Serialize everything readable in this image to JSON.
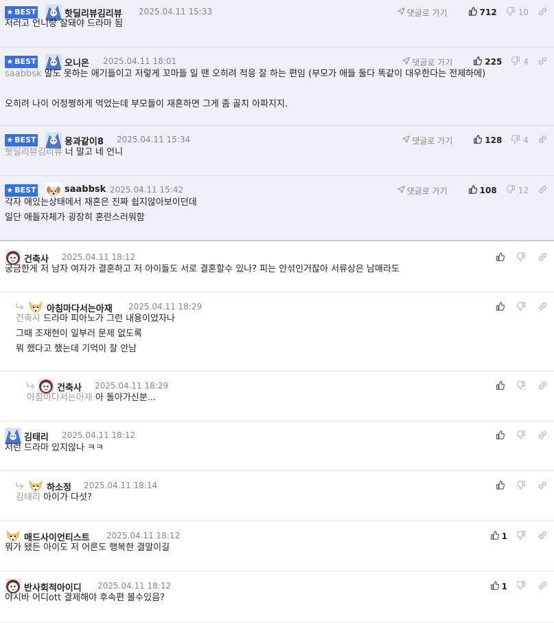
{
  "labels": {
    "best": "BEST",
    "reply": "댓글로 가기"
  },
  "colors": {
    "badge": "#3a6fd8",
    "best_bg": "#eef1f9"
  },
  "comments": [
    {
      "best": true,
      "nick": "핫딜리뷰김리뷰",
      "date": "2025.04.11 15:33",
      "likes": "712",
      "dislikes": "10",
      "mention": "",
      "lines": [
        "저러고 언니랑 잘돼야 드라마 됨"
      ],
      "avatar": "blue-avatar"
    },
    {
      "best": true,
      "nick": "오니온",
      "date": "2025.04.11 18:01",
      "likes": "225",
      "dislikes": "4",
      "mention": "saabbsk",
      "lines": [
        "말도 못하는 애기들이고 저렇게 꼬마들 일 땐 오히려 적응 잘 하는 편임 (부모가 애들 둘다 똑같이 대우한다는 전제하에)",
        "",
        "오히려 나이 어정쩡하게 먹었는데 부모들이 재혼하면 그게 좀 골치 아파지지."
      ],
      "avatar": "blue-avatar"
    },
    {
      "best": true,
      "nick": "용과같이8",
      "date": "2025.04.11 15:34",
      "likes": "128",
      "dislikes": "4",
      "mention": "핫딜리뷰김리뷰",
      "lines": [
        "너 말고 네 언니"
      ],
      "avatar": "blue-avatar"
    },
    {
      "best": true,
      "nick": "saabbsk",
      "date": "2025.04.11 15:42",
      "likes": "108",
      "dislikes": "12",
      "mention": "",
      "lines": [
        "각자 애있는상태에서 재혼은 진짜 쉽지않아보이던데",
        "일단 애들자체가 굉장히 혼란스러워함"
      ],
      "avatar": "dog-avatar"
    },
    {
      "best": false,
      "nick": "건축사",
      "date": "2025.04.11 18:12",
      "likes": "",
      "dislikes": "",
      "mention": "",
      "lines": [
        "궁금한게 저 남자 여자가 결혼하고 저 아이들도 서로 결혼할수 있나? 피는 안섞인거잖아 서류상은 남매라도"
      ],
      "avatar": "face-avatar"
    },
    {
      "best": false,
      "nick": "아침마다서는아재",
      "date": "2025.04.11 18:29",
      "likes": "",
      "dislikes": "",
      "mention": "건축사",
      "lines": [
        "드라마 피아노가 그런 내용이었자나",
        "그때 조재현이 일부러 문제 없도록",
        "뭐 했다고 했는데 기억이 잘 안남"
      ],
      "avatar": "fox-avatar"
    },
    {
      "best": false,
      "nick": "건축사",
      "date": "2025.04.11 18:29",
      "likes": "",
      "dislikes": "",
      "mention": "아침마다서는아재",
      "lines": [
        "아 돌아가신분..."
      ],
      "avatar": "face-avatar"
    },
    {
      "best": false,
      "nick": "김태리",
      "date": "2025.04.11 18:12",
      "likes": "",
      "dislikes": "",
      "mention": "",
      "lines": [
        "저런 드라마 있지않나 ㅋㅋ"
      ],
      "avatar": "blue-avatar"
    },
    {
      "best": false,
      "nick": "하소정",
      "date": "2025.04.11 18:14",
      "likes": "",
      "dislikes": "",
      "mention": "김태리",
      "lines": [
        "아이가 다섯?"
      ],
      "avatar": "fox-avatar"
    },
    {
      "best": false,
      "nick": "매드사이언티스트",
      "date": "2025.04.11 18:12",
      "likes": "1",
      "dislikes": "",
      "mention": "",
      "lines": [
        "뭐가 됐든 아이도 저 어른도 행복한 결말이길"
      ],
      "avatar": "fox-avatar"
    },
    {
      "best": false,
      "nick": "반사회적아이디",
      "date": "2025.04.11 18:12",
      "likes": "1",
      "dislikes": "",
      "mention": "",
      "lines": [
        "야시바 어디ott 결제해야 후속편 볼수있음?"
      ],
      "avatar": "face-avatar"
    }
  ]
}
